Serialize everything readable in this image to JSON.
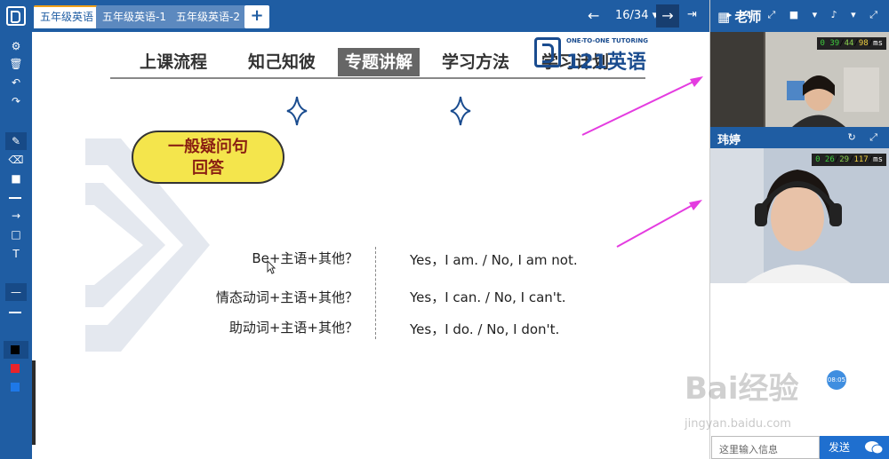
{
  "tabs": [
    {
      "label": "五年级英语",
      "active": true
    },
    {
      "label": "五年级英语-1",
      "active": false
    },
    {
      "label": "五年级英语-2",
      "active": false
    }
  ],
  "add_tab_label": "+",
  "pager": {
    "prev": "←",
    "indicator": "16/34 ▾",
    "next": "→",
    "exit": "⇥"
  },
  "toolbar": {
    "icons": [
      "gear-icon",
      "trash-icon",
      "undo-icon",
      "redo-icon",
      "pencil-icon",
      "eraser-icon",
      "filled-rect-icon",
      "line-icon",
      "arrow-icon",
      "rect-icon",
      "text-icon"
    ],
    "colors": [
      "#000000",
      "#e8232a",
      "#1e78e8"
    ]
  },
  "slide": {
    "nav": [
      "上课流程",
      "知己知彼",
      "专题讲解",
      "学习方法",
      "学习计划"
    ],
    "active_nav": "专题讲解",
    "brand": {
      "tagline": "ONE-TO-ONE TUTORING",
      "name": "121英语"
    },
    "pill": {
      "line1": "一般疑问句",
      "line2": "回答"
    },
    "rows": [
      {
        "question": "Be+主语+其他？",
        "answer": "Yes，I am. / No, I am not."
      },
      {
        "question": "情态动词+主语+其他？",
        "answer": "Yes，I can. / No, I can't."
      },
      {
        "question": "助动词+主语+其他？",
        "answer": "Yes，I do. / No, I don't."
      }
    ]
  },
  "teacher": {
    "title": "老师",
    "icons": "▸ ↻ ⤢ ■ ▾ ♪ ▾ ⤢",
    "stats": {
      "a": "0 39",
      "b": "44",
      "c": "98",
      "unit": "ms"
    }
  },
  "student": {
    "title": "玮婷",
    "icons": "↻ ⤢",
    "stats": {
      "a": "0 26",
      "b": "29",
      "c": "117",
      "unit": "ms"
    }
  },
  "timer_badge": "08:05",
  "watermark": "Bai经验",
  "watermark_url": "jingyan.baidu.com",
  "chat": {
    "placeholder": "这里输入信息",
    "send": "发送"
  },
  "colors": {
    "brand_blue": "#1f5da3",
    "pill_yellow": "#f4e54c",
    "arrow_magenta": "#e43ce0"
  }
}
